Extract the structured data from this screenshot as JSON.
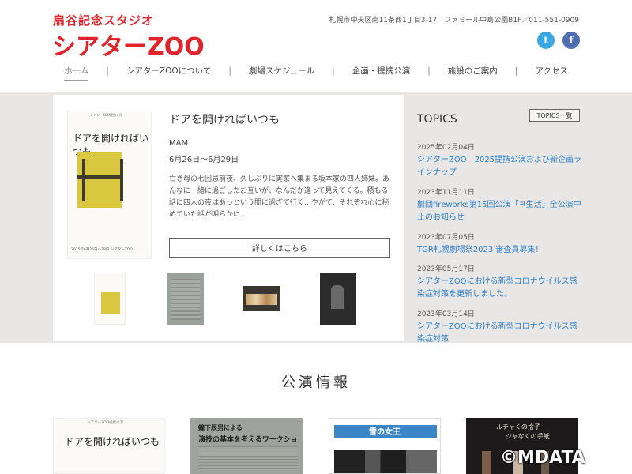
{
  "header": {
    "logo_small": "扇谷記念スタジオ",
    "logo_main": "シアターZOO",
    "address": "札幌市中央区南11条西1丁目3-17　ファミール中島公園B1F／011-551-0909",
    "sns": {
      "twitter": "t",
      "facebook": "f"
    }
  },
  "nav": {
    "items": [
      "ホーム",
      "シアターZOOについて",
      "劇場スケジュール",
      "企画・提携公演",
      "施設のご案内",
      "アクセス"
    ],
    "separator": "|"
  },
  "feature": {
    "title": "ドアを開ければいつも",
    "company": "MAM",
    "date": "6月26日〜6月29日",
    "description": "亡き母の七回忌前夜、久しぶりに実家へ集まる坂本家の四人姉妹。あんなに一緒に過ごしたお互いが、なんだか違って見えてくる。積もる話に四人の夜はあっという間に過ぎて行く…やがて、それぞれ心に秘めていた話が明らかに…",
    "more_label": "詳しくはこちら",
    "poster": {
      "top": "シアターZOO提携公演",
      "title": "ドアを開ければいつも",
      "bottom": "2025年6月26日〜29日 シアターZOO"
    }
  },
  "topics": {
    "title": "TOPICS",
    "all_label": "TOPICS一覧",
    "items": [
      {
        "date": "2025年02月04日",
        "text": "シアターZOO　2025提携公演および新企画ラインナップ"
      },
      {
        "date": "2023年11月11日",
        "text": "劇団fireworks第15回公演「ㅋ生活」全公演中止のお知らせ"
      },
      {
        "date": "2023年07月05日",
        "text": "TGR札幌劇場祭2023 審査員募集！"
      },
      {
        "date": "2023年05月17日",
        "text": "シアターZOOにおける新型コロナウイルス感染症対策を更新しました。"
      },
      {
        "date": "2023年03月14日",
        "text": "シアターZOOにおける新型コロナウイルス感染症対策"
      }
    ]
  },
  "performances": {
    "title": "公演情報",
    "cards": [
      {
        "top": "シアターZOO提携公演",
        "title": "ドアを開ければいつも"
      },
      {
        "line1": "鐘下辰男による",
        "line2": "演技の基本を考えるワークショップ"
      },
      {
        "title": "雪の女王"
      },
      {
        "line1": "ルチャくの捨子",
        "line2": "ジャなくの手紙"
      }
    ]
  },
  "watermark": "©MDATA",
  "colors": {
    "brand_red": "#e0242c",
    "link_blue": "#2a7fc9",
    "band_gray": "#e9e7e6"
  }
}
